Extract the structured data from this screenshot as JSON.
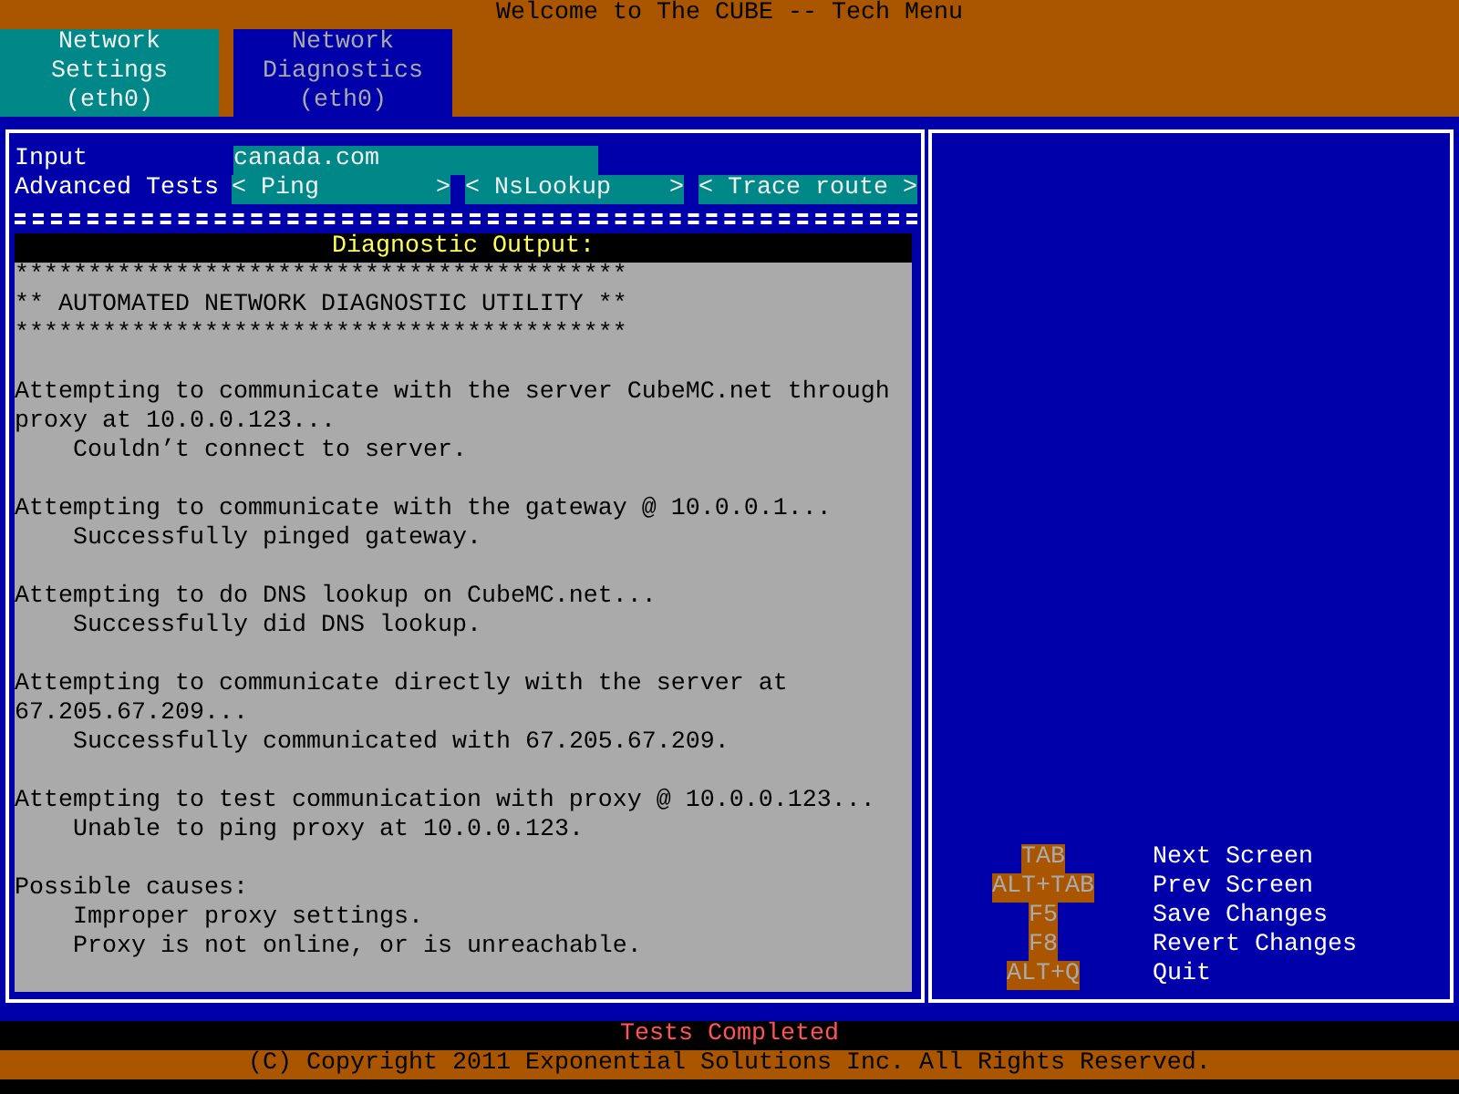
{
  "window": {
    "title": "Welcome to The CUBE -- Tech Menu"
  },
  "tabs": [
    {
      "lines": [
        "Network",
        "Settings",
        "(eth0)"
      ],
      "selected": false
    },
    {
      "lines": [
        "Network",
        "Diagnostics",
        "(eth0)"
      ],
      "selected": true
    }
  ],
  "form": {
    "input_label": "Input",
    "input_value": "canada.com",
    "tests_label": "Advanced Tests",
    "tests": [
      {
        "open": "<",
        "label": "Ping",
        "close": ">"
      },
      {
        "open": "<",
        "label": "NsLookup",
        "close": ">"
      },
      {
        "open": "<",
        "label": "Trace route",
        "close": ">"
      }
    ]
  },
  "output": {
    "title": "Diagnostic Output:",
    "blocks": [
      {
        "kind": "banner",
        "lines": [
          "******************************************",
          "** AUTOMATED NETWORK DIAGNOSTIC UTILITY **",
          "******************************************"
        ]
      },
      {
        "kind": "step",
        "text": "Attempting to communicate with the server CubeMC.net through proxy at 10.0.0.123...",
        "details": [
          "Couldn’t connect to server."
        ]
      },
      {
        "kind": "step",
        "text": "Attempting to communicate with the gateway @ 10.0.0.1...",
        "details": [
          "Successfully pinged gateway."
        ]
      },
      {
        "kind": "step",
        "text": "Attempting to do DNS lookup on CubeMC.net...",
        "details": [
          "Successfully did DNS lookup."
        ]
      },
      {
        "kind": "step",
        "text": "Attempting to communicate directly with the server at 67.205.67.209...",
        "details": [
          "Successfully communicated with 67.205.67.209."
        ]
      },
      {
        "kind": "step",
        "text": "Attempting to test communication with proxy @ 10.0.0.123...",
        "details": [
          "Unable to ping proxy at 10.0.0.123."
        ]
      },
      {
        "kind": "step",
        "text": "Possible causes:",
        "details": [
          "Improper proxy settings.",
          "Proxy is not online, or is unreachable."
        ]
      }
    ]
  },
  "keys": [
    {
      "key": "TAB",
      "action": "Next Screen"
    },
    {
      "key": "ALT+TAB",
      "action": "Prev Screen"
    },
    {
      "key": "F5",
      "action": "Save Changes"
    },
    {
      "key": "F8",
      "action": "Revert Changes"
    },
    {
      "key": "ALT+Q",
      "action": "Quit"
    }
  ],
  "status": "Tests Completed",
  "copyright": "(C) Copyright 2011 Exponential Solutions Inc. All Rights Reserved."
}
